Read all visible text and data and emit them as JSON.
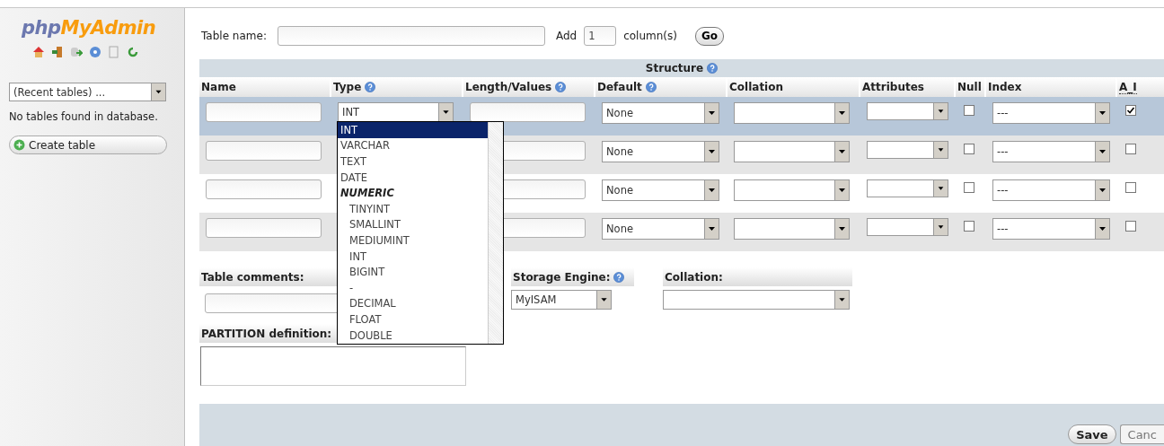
{
  "sidebar": {
    "logo_part_1": "php",
    "logo_part_2": "MyAdmin",
    "recent_tables": "(Recent tables) ...",
    "message": "No tables found in database.",
    "create_button": "Create table"
  },
  "table_name": {
    "label": "Table name:"
  },
  "add": {
    "label": "Add",
    "count": "1",
    "suffix": "column(s)",
    "button": "Go"
  },
  "structure": {
    "title": "Structure"
  },
  "columns": [
    {
      "label": "Name",
      "help": false,
      "abbr": false
    },
    {
      "label": "Type",
      "help": true,
      "abbr": false
    },
    {
      "label": "Length/Values",
      "help": true,
      "abbr": false
    },
    {
      "label": "Default",
      "help": true,
      "abbr": false
    },
    {
      "label": "Collation",
      "help": false,
      "abbr": false
    },
    {
      "label": "Attributes",
      "help": false,
      "abbr": false
    },
    {
      "label": "Null",
      "help": false,
      "abbr": false
    },
    {
      "label": "Index",
      "help": false,
      "abbr": false
    },
    {
      "label": "A_I",
      "help": false,
      "abbr": true
    }
  ],
  "rows": [
    {
      "type": "INT",
      "default": "None",
      "index": "---",
      "null": false,
      "auto_increment": true,
      "highlighted": true
    },
    {
      "default": "None",
      "index": "---",
      "null": false,
      "auto_increment": false,
      "highlighted": false
    },
    {
      "default": "None",
      "index": "---",
      "null": false,
      "auto_increment": false,
      "highlighted": false
    },
    {
      "default": "None",
      "index": "---",
      "null": false,
      "auto_increment": false,
      "highlighted": false
    }
  ],
  "type_dropdown": {
    "options": [
      {
        "label": "INT",
        "kind": "option",
        "selected": true
      },
      {
        "label": "VARCHAR",
        "kind": "option",
        "selected": false
      },
      {
        "label": "TEXT",
        "kind": "option",
        "selected": false
      },
      {
        "label": "DATE",
        "kind": "option",
        "selected": false
      },
      {
        "label": "NUMERIC",
        "kind": "group",
        "selected": false
      },
      {
        "label": "TINYINT",
        "kind": "suboption",
        "selected": false
      },
      {
        "label": "SMALLINT",
        "kind": "suboption",
        "selected": false
      },
      {
        "label": "MEDIUMINT",
        "kind": "suboption",
        "selected": false
      },
      {
        "label": "INT",
        "kind": "suboption",
        "selected": false
      },
      {
        "label": "BIGINT",
        "kind": "suboption",
        "selected": false
      },
      {
        "label": "-",
        "kind": "suboption",
        "selected": false
      },
      {
        "label": "DECIMAL",
        "kind": "suboption",
        "selected": false
      },
      {
        "label": "FLOAT",
        "kind": "suboption",
        "selected": false
      },
      {
        "label": "DOUBLE",
        "kind": "suboption",
        "selected": false
      }
    ]
  },
  "table_comments": {
    "label": "Table comments:"
  },
  "storage_engine": {
    "label": "Storage Engine:",
    "value": "MyISAM",
    "help": true
  },
  "collation": {
    "label": "Collation:"
  },
  "partition": {
    "label": "PARTITION definition:"
  },
  "footer": {
    "buttons": [
      {
        "label": "Save",
        "kind": "primary"
      },
      {
        "label": "Canc",
        "kind": "cut"
      }
    ]
  }
}
